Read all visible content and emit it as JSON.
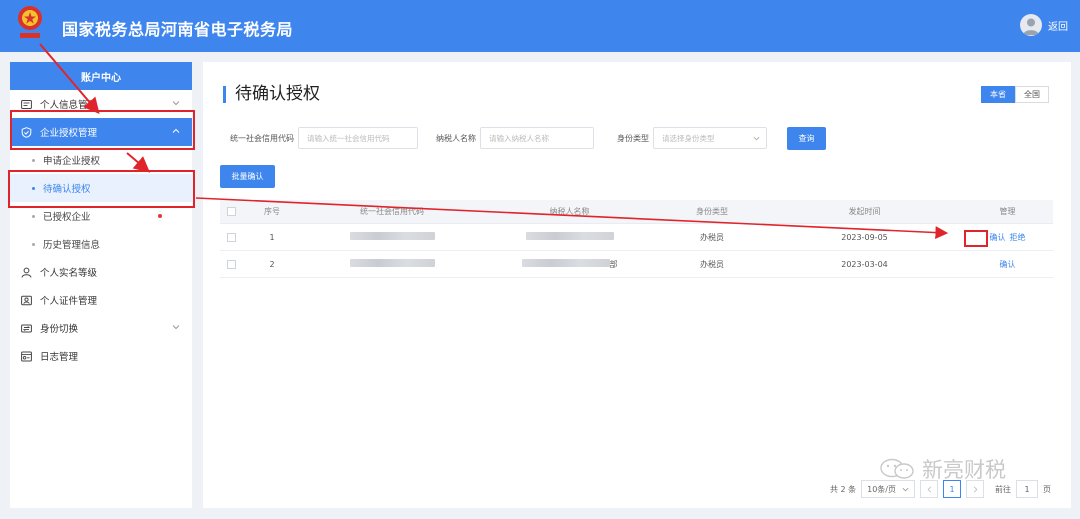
{
  "header": {
    "site_title": "国家税务总局河南省电子税务局",
    "return_label": "返回"
  },
  "sidebar": {
    "title": "账户中心",
    "items": [
      {
        "label": "个人信息管理",
        "icon": "profile-card-icon"
      },
      {
        "label": "企业授权管理",
        "icon": "shield-check-icon"
      },
      {
        "label": "申请企业授权"
      },
      {
        "label": "待确认授权"
      },
      {
        "label": "已授权企业"
      },
      {
        "label": "历史管理信息"
      },
      {
        "label": "个人实名等级",
        "icon": "user-icon"
      },
      {
        "label": "个人证件管理",
        "icon": "id-card-icon"
      },
      {
        "label": "身份切换",
        "icon": "switch-icon"
      },
      {
        "label": "日志管理",
        "icon": "log-icon"
      }
    ]
  },
  "main": {
    "title": "待确认授权",
    "scope": {
      "current": "本省",
      "all": "全国"
    },
    "filters": {
      "credit_code_label": "统一社会信用代码",
      "credit_code_placeholder": "请输入统一社会信用代码",
      "taxpayer_name_label": "纳税人名称",
      "taxpayer_name_placeholder": "请输入纳税人名称",
      "identity_type_label": "身份类型",
      "identity_type_placeholder": "请选择身份类型"
    },
    "query_label": "查询",
    "batch_confirm_label": "批量确认",
    "table": {
      "columns": [
        "序号",
        "统一社会信用代码",
        "纳税人名称",
        "身份类型",
        "发起时间",
        "管理"
      ],
      "rows": [
        {
          "no": "1",
          "identity_type": "办税员",
          "time": "2023-09-05",
          "confirm": "确认",
          "reject": "拒绝"
        },
        {
          "no": "2",
          "name_suffix": "部",
          "identity_type": "办税员",
          "time": "2023-03-04",
          "confirm": "确认"
        }
      ]
    },
    "pagination": {
      "total": "共 2 条",
      "page_size": "10条/页",
      "current_page": "1",
      "goto_label": "前往",
      "goto_value": "1",
      "page_unit": "页"
    }
  },
  "watermark": {
    "text": "新亮财税"
  },
  "colors": {
    "primary": "#3e86ee",
    "annotation_red": "#e0242b"
  }
}
